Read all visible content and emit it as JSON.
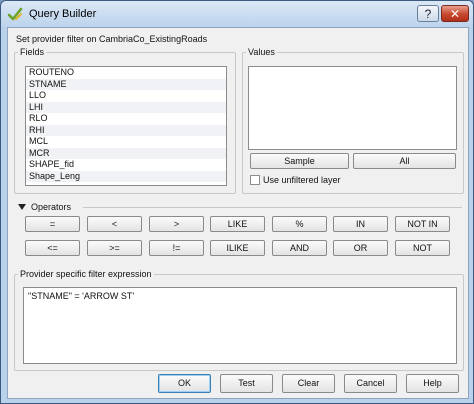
{
  "window": {
    "title": "Query Builder",
    "help_glyph": "?",
    "close_glyph": "✕"
  },
  "header": {
    "provider_label": "Set provider filter on CambriaCo_ExistingRoads"
  },
  "fields": {
    "title": "Fields",
    "items": [
      "ROUTENO",
      "STNAME",
      "LLO",
      "LHI",
      "RLO",
      "RHI",
      "MCL",
      "MCR",
      "SHAPE_fid",
      "Shape_Leng"
    ],
    "selected": "STNAME"
  },
  "values": {
    "title": "Values",
    "sample_label": "Sample",
    "all_label": "All",
    "unfiltered_label": "Use unfiltered layer",
    "unfiltered_checked": false
  },
  "operators": {
    "title": "Operators",
    "row1": [
      "=",
      "<",
      ">",
      "LIKE",
      "%",
      "IN",
      "NOT IN"
    ],
    "row2": [
      "<=",
      ">=",
      "!=",
      "ILIKE",
      "AND",
      "OR",
      "NOT"
    ]
  },
  "expression": {
    "title": "Provider specific filter expression",
    "value": "\"STNAME\" = 'ARROW ST'"
  },
  "footer": {
    "ok_label": "OK",
    "test_label": "Test",
    "clear_label": "Clear",
    "cancel_label": "Cancel",
    "help_label": "Help"
  },
  "colors": {
    "window_frame": "#b9d1ea",
    "dialog_bg": "#f0f0f0",
    "close_button": "#c7472e",
    "default_button_border": "#3c7fb1"
  }
}
